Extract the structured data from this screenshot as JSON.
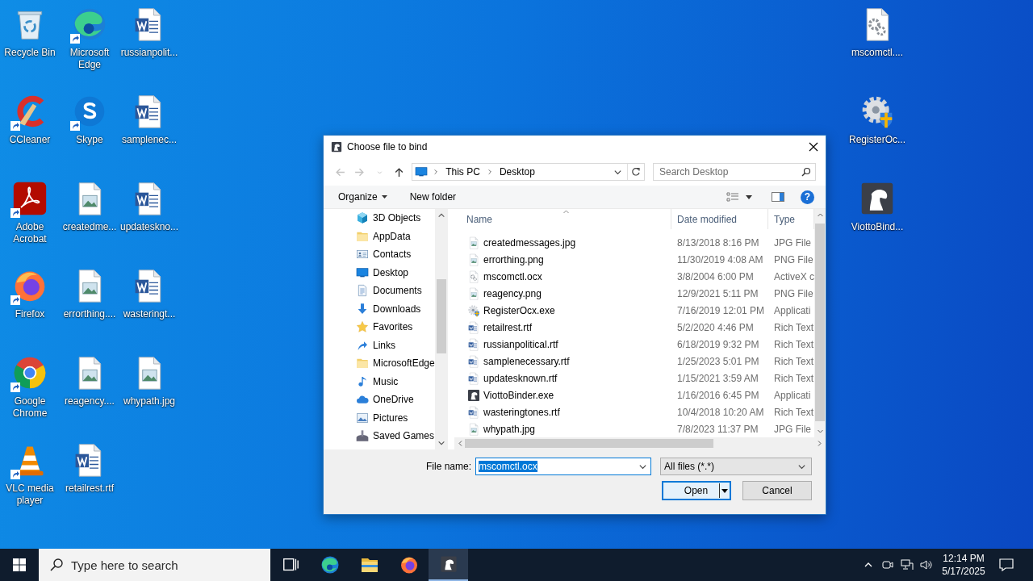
{
  "desktop": {
    "left_icons": [
      {
        "label": "Recycle Bin",
        "kind": "recycle",
        "shortcut": false
      },
      {
        "label": "CCleaner",
        "kind": "ccleaner",
        "shortcut": true
      },
      {
        "label": "Adobe Acrobat",
        "kind": "acrobat",
        "shortcut": true
      },
      {
        "label": "Firefox",
        "kind": "firefox",
        "shortcut": true
      },
      {
        "label": "Google Chrome",
        "kind": "chrome",
        "shortcut": true
      },
      {
        "label": "VLC media player",
        "kind": "vlc",
        "shortcut": true
      },
      {
        "label": "Microsoft Edge",
        "kind": "edge",
        "shortcut": true
      },
      {
        "label": "Skype",
        "kind": "skype",
        "shortcut": true
      },
      {
        "label": "createdme...",
        "kind": "image",
        "shortcut": false
      },
      {
        "label": "errorthing....",
        "kind": "image",
        "shortcut": false
      },
      {
        "label": "reagency....",
        "kind": "image",
        "shortcut": false
      },
      {
        "label": "retailrest.rtf",
        "kind": "word",
        "shortcut": false
      },
      {
        "label": "russianpolit...",
        "kind": "word",
        "shortcut": false
      },
      {
        "label": "samplenec...",
        "kind": "word",
        "shortcut": false
      },
      {
        "label": "updateskno...",
        "kind": "word",
        "shortcut": false
      },
      {
        "label": "wasteringt...",
        "kind": "word",
        "shortcut": false
      },
      {
        "label": "whypath.jpg",
        "kind": "image",
        "shortcut": false
      }
    ],
    "right_icons": [
      {
        "label": "mscomctl....",
        "kind": "gearfile",
        "shortcut": false
      },
      {
        "label": "RegisterOc...",
        "kind": "regocx",
        "shortcut": false
      },
      {
        "label": "ViottoBind...",
        "kind": "viotto",
        "shortcut": false
      }
    ]
  },
  "dialog": {
    "title": "Choose file to bind",
    "nav_buttons": [
      {
        "kind": "back",
        "disabled": true
      },
      {
        "kind": "forward",
        "disabled": true
      },
      {
        "kind": "recent",
        "disabled": true
      },
      {
        "kind": "up",
        "disabled": false
      }
    ],
    "breadcrumb": [
      "This PC",
      "Desktop"
    ],
    "search": {
      "placeholder": "Search Desktop"
    },
    "toolbar": [
      {
        "label": "Organize",
        "dropdown": true
      },
      {
        "label": "New folder",
        "dropdown": false
      }
    ],
    "help_label": "?",
    "nav_items": [
      {
        "label": "3D Objects",
        "kind": "cube"
      },
      {
        "label": "AppData",
        "kind": "folder"
      },
      {
        "label": "Contacts",
        "kind": "contacts"
      },
      {
        "label": "Desktop",
        "kind": "desktop"
      },
      {
        "label": "Documents",
        "kind": "documents"
      },
      {
        "label": "Downloads",
        "kind": "download"
      },
      {
        "label": "Favorites",
        "kind": "star"
      },
      {
        "label": "Links",
        "kind": "link"
      },
      {
        "label": "MicrosoftEdge",
        "kind": "folder"
      },
      {
        "label": "Music",
        "kind": "music"
      },
      {
        "label": "OneDrive",
        "kind": "cloud"
      },
      {
        "label": "Pictures",
        "kind": "pictures"
      },
      {
        "label": "Saved Games",
        "kind": "games"
      }
    ],
    "columns": [
      {
        "label": "Name",
        "sorted": true
      },
      {
        "label": "Date modified",
        "sorted": false
      },
      {
        "label": "Type",
        "sorted": false
      }
    ],
    "files": [
      {
        "name": "createdmessages.jpg",
        "kind": "image",
        "date": "8/13/2018 8:16 PM",
        "type": "JPG File"
      },
      {
        "name": "errorthing.png",
        "kind": "image",
        "date": "11/30/2019 4:08 AM",
        "type": "PNG File"
      },
      {
        "name": "mscomctl.ocx",
        "kind": "gearfile",
        "date": "3/8/2004 6:00 PM",
        "type": "ActiveX c"
      },
      {
        "name": "reagency.png",
        "kind": "image",
        "date": "12/9/2021 5:11 PM",
        "type": "PNG File"
      },
      {
        "name": "RegisterOcx.exe",
        "kind": "regocx",
        "date": "7/16/2019 12:01 PM",
        "type": "Applicati"
      },
      {
        "name": "retailrest.rtf",
        "kind": "word",
        "date": "5/2/2020 4:46 PM",
        "type": "Rich Text"
      },
      {
        "name": "russianpolitical.rtf",
        "kind": "word",
        "date": "6/18/2019 9:32 PM",
        "type": "Rich Text"
      },
      {
        "name": "samplenecessary.rtf",
        "kind": "word",
        "date": "1/25/2023 5:01 PM",
        "type": "Rich Text"
      },
      {
        "name": "updatesknown.rtf",
        "kind": "word",
        "date": "1/15/2021 3:59 AM",
        "type": "Rich Text"
      },
      {
        "name": "ViottoBinder.exe",
        "kind": "viotto",
        "date": "1/16/2016 6:45 PM",
        "type": "Applicati"
      },
      {
        "name": "wasteringtones.rtf",
        "kind": "word",
        "date": "10/4/2018 10:20 AM",
        "type": "Rich Text"
      },
      {
        "name": "whypath.jpg",
        "kind": "image",
        "date": "7/8/2023 11:37 PM",
        "type": "JPG File"
      }
    ],
    "file_name_label": "File name:",
    "file_name": {
      "value": "mscomctl.ocx",
      "value_selected": true
    },
    "filter": "All files (*.*)",
    "buttons": [
      {
        "label": "Open",
        "kind": "split",
        "default": true
      },
      {
        "label": "Cancel",
        "kind": "plain",
        "default": false
      }
    ]
  },
  "taskbar": {
    "search": {
      "placeholder": "Type here to search"
    },
    "apps": [
      {
        "kind": "taskview",
        "selected": false
      },
      {
        "kind": "edge",
        "selected": false
      },
      {
        "kind": "explorer",
        "selected": false
      },
      {
        "kind": "firefox",
        "selected": false
      },
      {
        "kind": "viotto",
        "selected": true
      }
    ],
    "time": "12:14 PM",
    "date": "5/17/2025"
  }
}
